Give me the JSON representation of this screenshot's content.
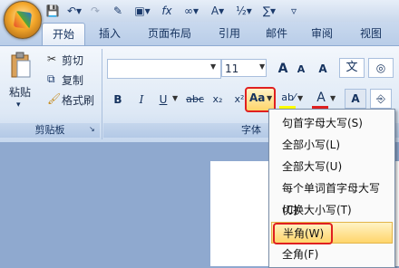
{
  "tabs": [
    "开始",
    "插入",
    "页面布局",
    "引用",
    "邮件",
    "审阅",
    "视图"
  ],
  "clipboard": {
    "paste": "粘贴",
    "cut": "剪切",
    "copy": "复制",
    "format_painter": "格式刷",
    "group": "剪贴板"
  },
  "font": {
    "size": "11",
    "group": "字体",
    "bold": "B",
    "italic": "I",
    "underline": "U",
    "strike": "abc",
    "subscript": "x₂",
    "change_case": "Aa",
    "grow": "A",
    "shrink": "A",
    "clear": "A",
    "wen": "文",
    "font_color": "A",
    "char_border": "A"
  },
  "menu": {
    "items": [
      "句首字母大写(S)",
      "全部小写(L)",
      "全部大写(U)",
      "每个单词首字母大写(C)",
      "切换大小写(T)",
      "半角(W)",
      "全角(F)"
    ],
    "highlighted_index": 5
  },
  "colors": {
    "highlight_marker": "#e02020",
    "font_color_bar": "#e02020",
    "text_highlight_bar": "#ffff00"
  }
}
